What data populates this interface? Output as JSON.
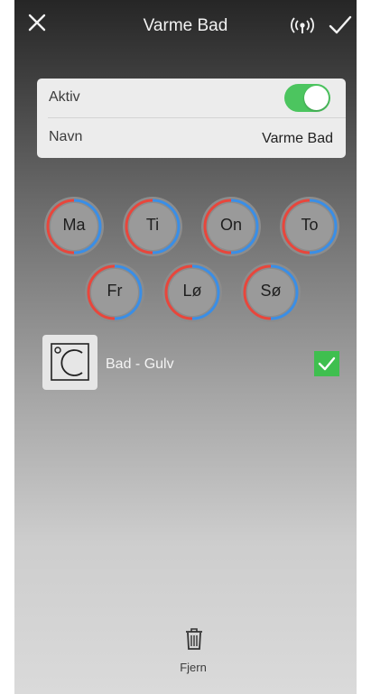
{
  "header": {
    "title": "Varme Bad",
    "close_icon": "close-icon",
    "signal_icon": "signal-icon",
    "confirm_icon": "checkmark-icon"
  },
  "settings": {
    "active_label": "Aktiv",
    "active_on": true,
    "name_label": "Navn",
    "name_value": "Varme Bad"
  },
  "days": [
    {
      "label": "Ma"
    },
    {
      "label": "Ti"
    },
    {
      "label": "On"
    },
    {
      "label": "To"
    },
    {
      "label": "Fr"
    },
    {
      "label": "Lø"
    },
    {
      "label": "Sø"
    }
  ],
  "device": {
    "name": "Bad - Gulv",
    "icon": "heating-floor-icon",
    "selected": true
  },
  "footer": {
    "remove_label": "Fjern",
    "remove_icon": "trash-icon"
  },
  "colors": {
    "accent_green": "#4cc55f",
    "ring_red": "#e8463c",
    "ring_blue": "#3a8ee6"
  }
}
